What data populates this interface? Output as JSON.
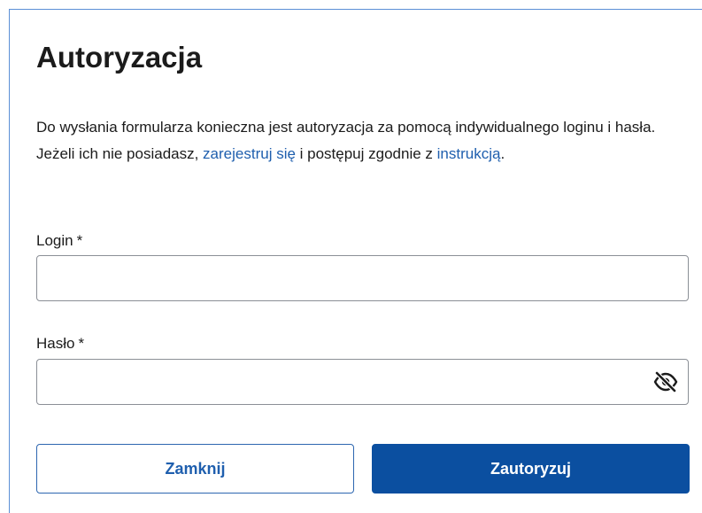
{
  "dialog": {
    "title": "Autoryzacja",
    "intro": {
      "part1": "Do wysłania formularza konieczna jest autoryzacja za pomocą indywidualnego loginu i hasła. Jeżeli ich nie posiadasz, ",
      "register_link": "zarejestruj się",
      "part2": " i postępuj zgodnie z ",
      "instructions_link": "instrukcją",
      "part3": "."
    },
    "login": {
      "label": "Login",
      "required_mark": "*",
      "value": ""
    },
    "password": {
      "label": "Hasło",
      "required_mark": "*",
      "value": "",
      "toggle_icon": "eye-slash-icon"
    },
    "buttons": {
      "close_label": "Zamknij",
      "submit_label": "Zautoryzuj"
    }
  },
  "colors": {
    "link": "#1f5fae",
    "primary": "#0b4fa0",
    "border": "#8b8f96"
  }
}
